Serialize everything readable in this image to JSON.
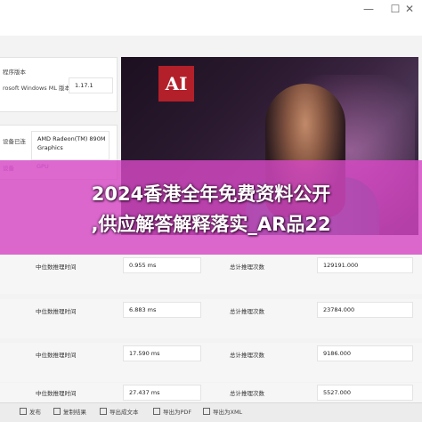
{
  "window": {
    "controls": {
      "minimize": "—",
      "maximize": "☐",
      "close": "✕"
    }
  },
  "left_panel": {
    "version_label": "程序版本",
    "ml_label": "rosoft Windows ML 版本",
    "ml_version": "1.17.1",
    "connected_label": "设备已连",
    "device_name": "AMD Radeon(TM) 890M Graphics",
    "device_type_label": "设备",
    "device_type": "GPU"
  },
  "hero": {
    "logo_text": "AI"
  },
  "overlay": {
    "line1": "2024香港全年免费资料公开",
    "line2": ",供应解答解释落实_AR品22"
  },
  "rows": [
    {
      "metric": "中位数推理时间",
      "value": "0.955 ms",
      "total_label": "总计推理次数",
      "total": "129191.000"
    },
    {
      "metric": "中位数推理时间",
      "value": "6.883 ms",
      "total_label": "总计推理次数",
      "total": "23784.000"
    },
    {
      "metric": "中位数推理时间",
      "value": "17.590 ms",
      "total_label": "总计推理次数",
      "total": "9186.000"
    },
    {
      "metric": "中位数推理时间",
      "value": "27.437 ms",
      "total_label": "总计推理次数",
      "total": "5527.000"
    }
  ],
  "bottom_bar": [
    {
      "icon": "share-icon",
      "label": "发布"
    },
    {
      "icon": "copy-icon",
      "label": "复制结果"
    },
    {
      "icon": "export-text-icon",
      "label": "导出成文本"
    },
    {
      "icon": "export-pdf-icon",
      "label": "导出为PDF"
    },
    {
      "icon": "export-xml-icon",
      "label": "导出为XML"
    }
  ]
}
